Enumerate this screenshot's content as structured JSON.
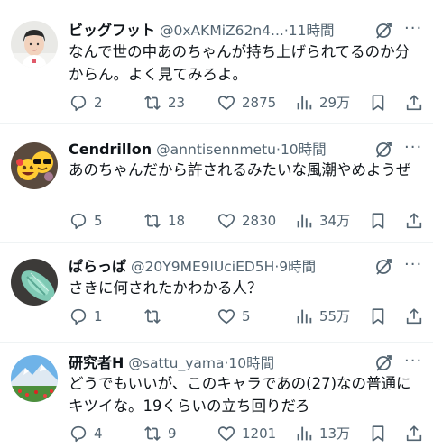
{
  "tweets": [
    {
      "name": "ビッグフット",
      "handle": "@0xAKMiZ62n4...",
      "dot": "·",
      "time": "11時間",
      "text": "なんで世の中あのちゃんが持ち上げられてるのか分からん。よく見てみろよ。",
      "replies": "2",
      "retweets": "23",
      "likes": "2875",
      "views": "29万"
    },
    {
      "name": "Cendrillon",
      "handle": "@anntisennmetu",
      "dot": "·",
      "time": "10時間",
      "text": "あのちゃんだから許されるみたいな風潮やめようぜ",
      "replies": "5",
      "retweets": "18",
      "likes": "2830",
      "views": "34万"
    },
    {
      "name": "ぱらっぱ",
      "handle": "@20Y9ME9lUciED5H",
      "dot": "·",
      "time": "9時間",
      "text": "さきに何されたかわかる人？",
      "replies": "1",
      "retweets": "",
      "likes": "5",
      "views": "55万"
    },
    {
      "name": "研究者H",
      "handle": "@sattu_yama",
      "dot": "·",
      "time": "10時間",
      "text": "どうでもいいが、このキャラであの(27)なの普通にキツイな。19くらいの立ち回りだろ",
      "replies": "4",
      "retweets": "9",
      "likes": "1201",
      "views": "13万"
    }
  ],
  "more_label": "···",
  "colors": {
    "icon_gray": "#536471",
    "text": "#0f1419",
    "divider": "#eff3f4"
  }
}
